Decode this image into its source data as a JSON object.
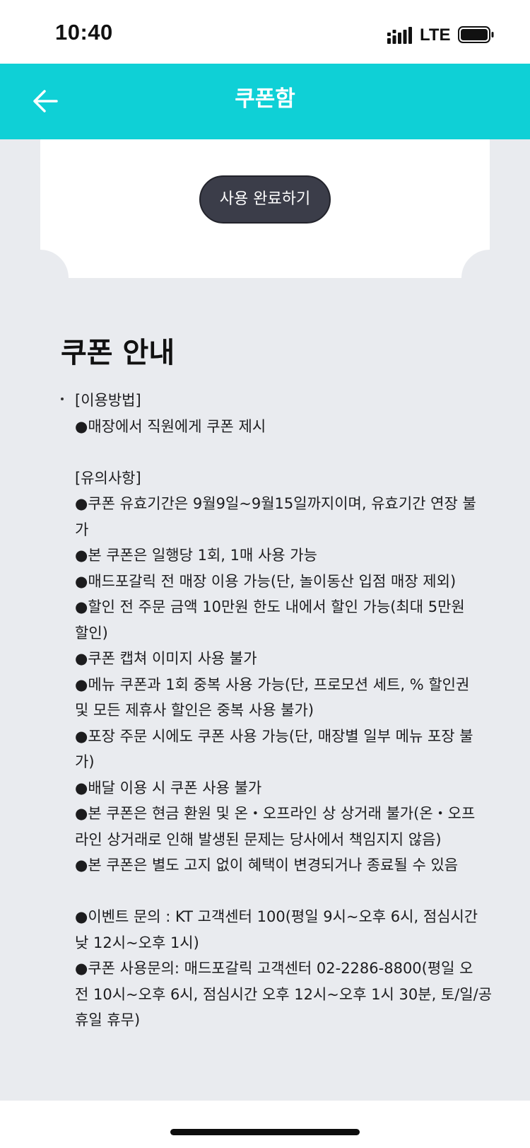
{
  "status_bar": {
    "time": "10:40",
    "network": "LTE"
  },
  "header": {
    "title": "쿠폰함"
  },
  "coupon": {
    "complete_button_label": "사용 완료하기"
  },
  "info": {
    "title": "쿠폰 안내",
    "lines": [
      "[이용방법]",
      "●매장에서 직원에게 쿠폰 제시",
      "",
      "[유의사항]",
      "●쿠폰 유효기간은 9월9일~9월15일까지이며, 유효기간 연장 불",
      "가",
      "●본 쿠폰은 일행당 1회, 1매 사용 가능",
      "●매드포갈릭 전 매장 이용 가능(단, 놀이동산 입점 매장 제외)",
      "●할인 전 주문 금액 10만원 한도 내에서 할인 가능(최대 5만원",
      "할인)",
      "●쿠폰 캡쳐 이미지 사용 불가",
      "●메뉴 쿠폰과 1회 중복 사용 가능(단, 프로모션 세트, % 할인권",
      "및 모든 제휴사 할인은 중복 사용 불가)",
      "●포장 주문 시에도 쿠폰 사용 가능(단, 매장별 일부 메뉴 포장 불",
      "가)",
      "●배달 이용 시 쿠폰 사용 불가",
      "●본 쿠폰은 현금 환원 및 온・오프라인 상 상거래 불가(온・오프",
      "라인 상거래로 인해 발생된 문제는 당사에서 책임지지 않음)",
      "●본 쿠폰은 별도 고지 없이 혜택이 변경되거나 종료될 수 있음",
      "",
      "●이벤트 문의 : KT 고객센터 100(평일 9시~오후 6시, 점심시간",
      "낮 12시~오후 1시)",
      "●쿠폰 사용문의: 매드포갈릭 고객센터 02-2286-8800(평일 오",
      "전 10시~오후 6시, 점심시간 오후 12시~오후 1시 30분, 토/일/공",
      "휴일 휴무)"
    ]
  },
  "colors": {
    "header_bg": "#0fd0d6",
    "page_bg": "#e9ebef",
    "button_bg": "#3b3d49"
  }
}
